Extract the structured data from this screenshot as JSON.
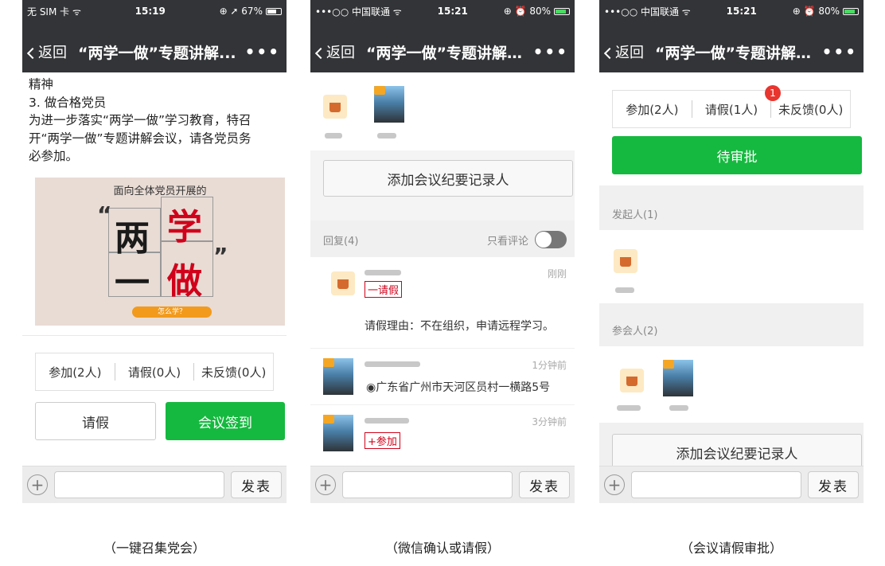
{
  "p1": {
    "status": {
      "left": "无 SIM 卡 ᯤ",
      "time": "15:19",
      "right": "⊕ ➚ 67%"
    },
    "back": "返回",
    "title": "“两学一做”专题讲解...",
    "more": "•••",
    "text_lines": [
      "精神",
      "3. 做合格党员",
      "为进一步落实“两学一做”学习教育，特召",
      "开“两学一做”专题讲解会议，请各党员务",
      "必参加。"
    ],
    "poster": {
      "top": "面向全体党员开展的",
      "c1": "两",
      "c2": "学",
      "c3": "一",
      "c4": "做",
      "q_open": "“",
      "q_close": "”",
      "pill": "怎么学？"
    },
    "stats": [
      "参加(2人)",
      "请假(0人)",
      "未反馈(0人)"
    ],
    "leave_button": "请假",
    "signin_button": "会议签到",
    "send": "发表",
    "plus": "+",
    "caption": "（一键召集党会）"
  },
  "p2": {
    "status": {
      "left": "•••○○ 中国联通 ᯤ",
      "time": "15:21",
      "right": "⊕ ⏰ 80%"
    },
    "back": "返回",
    "title": "“两学一做”专题讲解会...",
    "more": "•••",
    "add_recorder": "添加会议纪要记录人",
    "reply_count": "回复(4)",
    "only_comments": "只看评论",
    "r1": {
      "time": "刚刚",
      "tag": "一请假",
      "reason": "请假理由：不在组织，申请远程学习。"
    },
    "r2": {
      "time": "1分钟前",
      "location": "◉广东省广州市天河区员村一横路5号"
    },
    "r3": {
      "time": "3分钟前",
      "tag": "+参加"
    },
    "send": "发表",
    "plus": "+",
    "caption": "（微信确认或请假）"
  },
  "p3": {
    "status": {
      "left": "•••○○ 中国联通 ᯤ",
      "time": "15:21",
      "right": "⊕ ⏰ 80%"
    },
    "back": "返回",
    "title": "“两学一做”专题讲解会...",
    "more": "•••",
    "stats": [
      "参加(2人)",
      "请假(1人)",
      "未反馈(0人)"
    ],
    "badge": "1",
    "pending_button": "待审批",
    "initiator_label": "发起人(1)",
    "attendee_label": "参会人(2)",
    "add_recorder": "添加会议纪要记录人",
    "send": "发表",
    "plus": "+",
    "caption": "（会议请假审批）"
  },
  "colors": {
    "header": "#333437",
    "green": "#15b93f",
    "red": "#d0021b"
  }
}
